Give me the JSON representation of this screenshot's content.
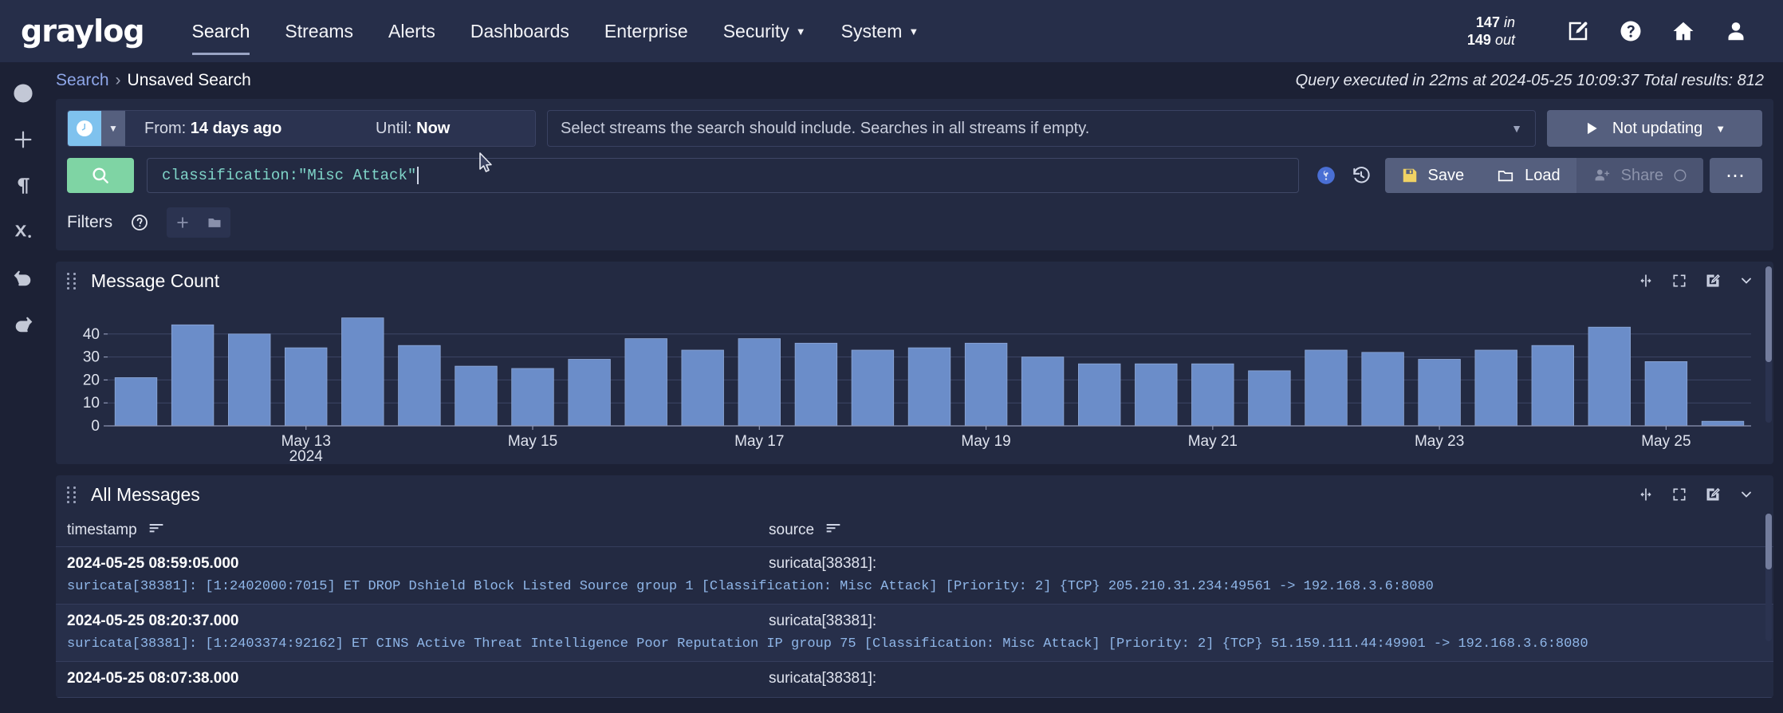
{
  "brand": {
    "logo": "graylog"
  },
  "nav": {
    "items": [
      {
        "label": "Search",
        "active": true,
        "dropdown": false
      },
      {
        "label": "Streams",
        "active": false,
        "dropdown": false
      },
      {
        "label": "Alerts",
        "active": false,
        "dropdown": false
      },
      {
        "label": "Dashboards",
        "active": false,
        "dropdown": false
      },
      {
        "label": "Enterprise",
        "active": false,
        "dropdown": false
      },
      {
        "label": "Security",
        "active": false,
        "dropdown": true
      },
      {
        "label": "System",
        "active": false,
        "dropdown": true
      }
    ],
    "throughput_in": "147",
    "throughput_in_unit": "in",
    "throughput_out": "149",
    "throughput_out_unit": "out",
    "icons": [
      "edit-icon",
      "help-icon",
      "home-icon",
      "user-icon"
    ]
  },
  "rail": {
    "items": [
      "info-icon",
      "plus-icon",
      "paragraph-icon",
      "clear-x-icon",
      "undo-icon",
      "redo-icon"
    ]
  },
  "breadcrumb": {
    "root": "Search",
    "separator": "›",
    "current": "Unsaved Search"
  },
  "query_info": "Query executed in 22ms at 2024-05-25 10:09:37 Total results: 812",
  "timerange": {
    "from_label": "From:",
    "from_value": "14 days ago",
    "until_label": "Until:",
    "until_value": "Now"
  },
  "streams": {
    "placeholder": "Select streams the search should include. Searches in all streams if empty."
  },
  "refresh": {
    "label": "Not updating"
  },
  "search": {
    "query": "classification:\"Misc Attack\""
  },
  "actions": {
    "save": "Save",
    "load": "Load",
    "share": "Share",
    "more": "⋯"
  },
  "filters": {
    "label": "Filters"
  },
  "widgets": {
    "message_count": {
      "title": "Message Count"
    },
    "all_messages": {
      "title": "All Messages"
    }
  },
  "messages_table": {
    "columns": [
      "timestamp",
      "source"
    ],
    "rows": [
      {
        "timestamp": "2024-05-25 08:59:05.000",
        "source": "suricata[38381]:",
        "body": "suricata[38381]: [1:2402000:7015] ET DROP Dshield Block Listed Source group 1 [Classification: Misc Attack] [Priority: 2] {TCP} 205.210.31.234:49561 -> 192.168.3.6:8080"
      },
      {
        "timestamp": "2024-05-25 08:20:37.000",
        "source": "suricata[38381]:",
        "body": "suricata[38381]: [1:2403374:92162] ET CINS Active Threat Intelligence Poor Reputation IP group 75 [Classification: Misc Attack] [Priority: 2] {TCP} 51.159.111.44:49901 -> 192.168.3.6:8080"
      },
      {
        "timestamp": "2024-05-25 08:07:38.000",
        "source": "suricata[38381]:",
        "body": ""
      }
    ]
  },
  "colors": {
    "navbar_bg": "#262e49",
    "page_bg": "#1c2135",
    "panel_bg": "#232a42",
    "bar_fill": "#6b8dc9",
    "accent_green": "#7fd4a4",
    "accent_blue": "#7fc2ee",
    "link_blue": "#8ea6e8",
    "save_yellow": "#f0d264"
  },
  "chart_data": {
    "type": "bar",
    "title": "Message Count",
    "xlabel": "",
    "ylabel": "",
    "ylim": [
      0,
      50
    ],
    "yticks": [
      0,
      10,
      20,
      30,
      40
    ],
    "grid": true,
    "legend": null,
    "tick_labels": [
      "May 13",
      "May 15",
      "May 17",
      "May 19",
      "May 21",
      "May 23",
      "May 25"
    ],
    "tick_sublabel": "2024",
    "tick_positions": [
      3,
      7,
      11,
      15,
      19,
      23,
      27
    ],
    "categories": [
      "1",
      "2",
      "3",
      "4",
      "5",
      "6",
      "7",
      "8",
      "9",
      "10",
      "11",
      "12",
      "13",
      "14",
      "15",
      "16",
      "17",
      "18",
      "19",
      "20",
      "21",
      "22",
      "23",
      "24",
      "25",
      "26",
      "27",
      "28"
    ],
    "values": [
      21,
      44,
      40,
      34,
      47,
      35,
      26,
      25,
      29,
      38,
      33,
      38,
      36,
      33,
      34,
      36,
      30,
      27,
      27,
      27,
      24,
      33,
      32,
      29,
      33,
      35,
      43,
      28,
      2
    ]
  }
}
